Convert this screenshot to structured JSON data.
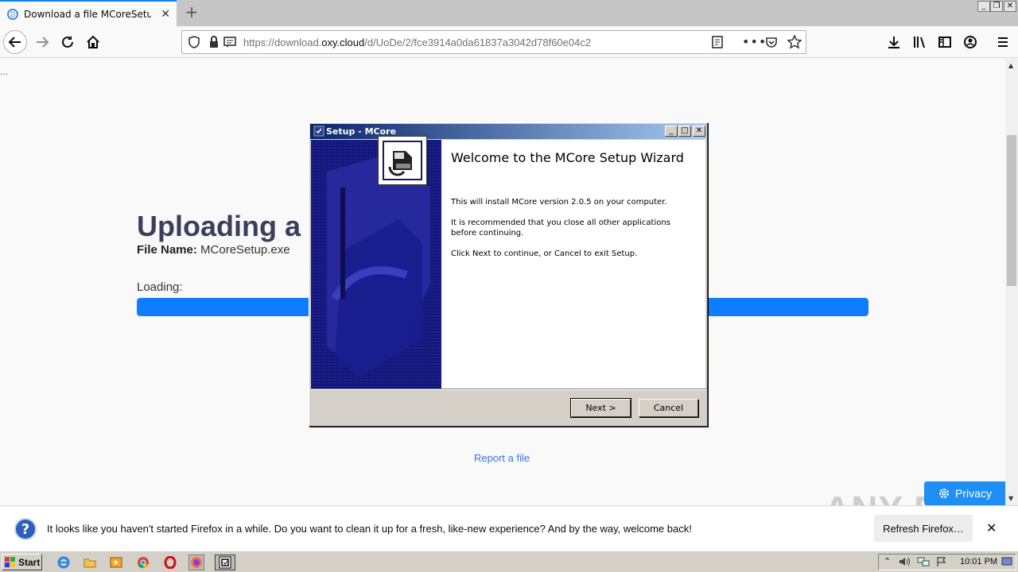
{
  "browser": {
    "tab_title": "Download a file MCoreSetup.exe o",
    "url_prefix": "https://download.",
    "url_host": "oxy.cloud",
    "url_path": "/d/UoDe/2/fce3914a0da61837a3042d78f60e04c2"
  },
  "page": {
    "dots": "...",
    "heading": "Uploading a",
    "file_name_label": "File Name:",
    "file_name_value": "MCoreSetup.exe",
    "loading_label": "Loading:",
    "progress_fraction": 1.0,
    "report_link": "Report a file",
    "privacy_button": "Privacy",
    "watermark": "ANY RUN"
  },
  "dialog": {
    "title": "Setup - MCore",
    "heading": "Welcome to the MCore Setup Wizard",
    "p1": "This will install MCore version 2.0.5 on your computer.",
    "p2": "It is recommended that you close all other applications before continuing.",
    "p3": "Click Next to continue, or Cancel to exit Setup.",
    "next_label": "Next >",
    "cancel_label": "Cancel"
  },
  "notification": {
    "text": "It looks like you haven't started Firefox in a while. Do you want to clean it up for a fresh, like-new experience? And by the way, welcome back!",
    "button": "Refresh Firefox…"
  },
  "taskbar": {
    "start_label": "Start",
    "clock": "10:01 PM"
  },
  "colors": {
    "accent": "#0a84ff",
    "progress": "#0f7dff",
    "heading": "#3a3f5c",
    "dialog_title_start": "#0a246a",
    "dialog_left_panel": "#14177a"
  }
}
